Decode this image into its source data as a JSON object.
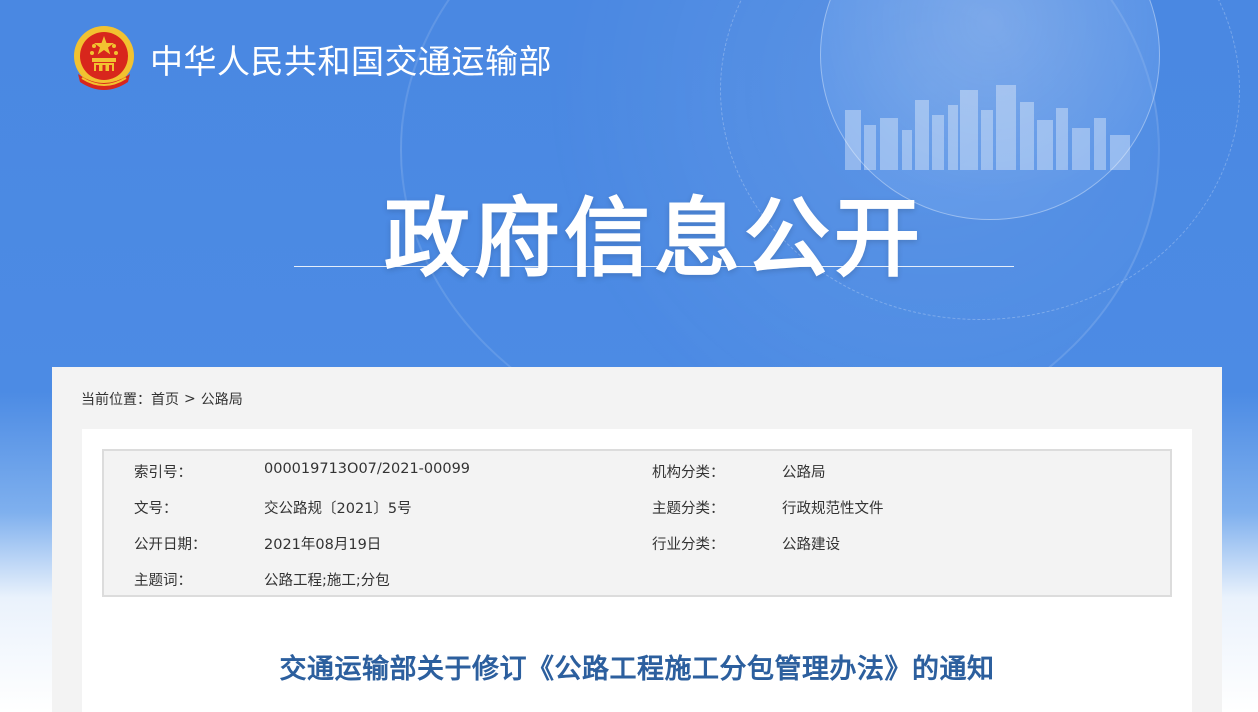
{
  "header": {
    "ministry_name": "中华人民共和国交通运输部",
    "section_title": "政府信息公开"
  },
  "breadcrumb": {
    "label": "当前位置：",
    "items": [
      "首页",
      "公路局"
    ],
    "separator": ">"
  },
  "meta": {
    "index_no_label": "索引号：",
    "index_no": "000019713O07/2021-00099",
    "org_label": "机构分类：",
    "org": "公路局",
    "doc_no_label": "文号：",
    "doc_no": "交公路规〔2021〕5号",
    "topic_label": "主题分类：",
    "topic": "行政规范性文件",
    "date_label": "公开日期：",
    "date": "2021年08月19日",
    "industry_label": "行业分类：",
    "industry": "公路建设",
    "keywords_label": "主题词：",
    "keywords": "公路工程;施工;分包"
  },
  "document": {
    "title": "交通运输部关于修订《公路工程施工分包管理办法》的通知"
  },
  "colors": {
    "banner_blue": "#4a88e2",
    "title_blue": "#2c5f9e",
    "panel_gray": "#f3f3f3"
  },
  "icons": {
    "emblem": "national-emblem-icon"
  }
}
